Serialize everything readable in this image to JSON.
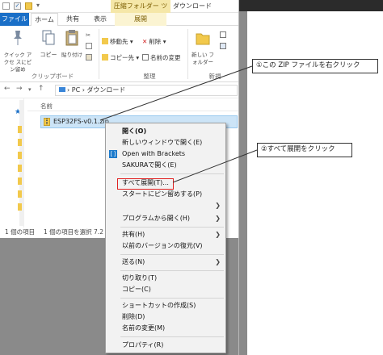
{
  "titlebar": {
    "context_tab_title": "圧縮フォルダー ツール",
    "window_title": "ダウンロード"
  },
  "ribbon": {
    "tabs": [
      {
        "label": "ファイル"
      },
      {
        "label": "ホーム"
      },
      {
        "label": "共有"
      },
      {
        "label": "表示"
      },
      {
        "label": "展開"
      }
    ],
    "clipboard": {
      "pin_label": "クイック アクセ スにピン留め",
      "copy_label": "コピー",
      "paste_label": "貼り付け",
      "group_label": "クリップボード"
    },
    "organize": {
      "move_label": "移動先",
      "copy_to_label": "コピー先",
      "delete_label": "削除",
      "rename_label": "名前の変更",
      "group_label": "整理"
    },
    "new": {
      "new_folder_label": "新しい フォルダー",
      "group_label": "新規"
    }
  },
  "address": {
    "path": "›  PC  ›  ダウンロード"
  },
  "content": {
    "column_header": "名前",
    "file_name": "ESP32FS-v0.1.zip"
  },
  "status": {
    "item_count": "1 個の項目",
    "selected": "1 個の項目を選択 7.2"
  },
  "context_menu": {
    "open": "開く(O)",
    "open_new_window": "新しいウィンドウで開く(E)",
    "open_with_brackets": "Open with Brackets",
    "sakura": "SAKURAで開く(E)",
    "extract_all": "すべて展開(T)...",
    "pin_start": "スタートにピン留めする(P)",
    "open_with": "プログラムから開く(H)",
    "share": "共有(H)",
    "restore_previous": "以前のバージョンの復元(V)",
    "send_to": "送る(N)",
    "cut": "切り取り(T)",
    "copy": "コピー(C)",
    "create_shortcut": "ショートカットの作成(S)",
    "delete": "削除(D)",
    "rename": "名前の変更(M)",
    "properties": "プロパティ(R)"
  },
  "callouts": {
    "step1": "①この ZIP ファイルを右クリック",
    "step2": "②すべて展開をクリック"
  },
  "colors": {
    "file_tab": "#1a6fc7",
    "selection": "#cce4f7",
    "highlight_box": "#e02020"
  }
}
